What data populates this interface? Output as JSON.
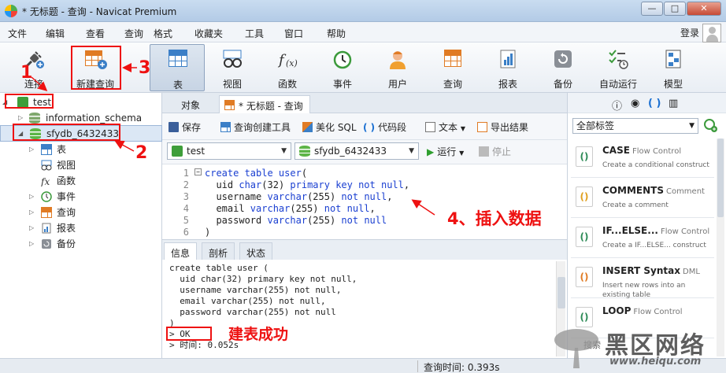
{
  "window": {
    "title": "* 无标题 - 查询 - Navicat Premium",
    "min": "—",
    "max": "□",
    "close": "✕"
  },
  "menu": [
    "文件",
    "编辑",
    "查看",
    "查询",
    "格式",
    "收藏夹",
    "工具",
    "窗口",
    "帮助"
  ],
  "login": "登录",
  "toolbar": [
    {
      "label": "连接",
      "icon": "plug-icon"
    },
    {
      "label": "新建查询",
      "icon": "new-query-icon"
    },
    {
      "label": "表",
      "icon": "table-icon"
    },
    {
      "label": "视图",
      "icon": "view-icon"
    },
    {
      "label": "函数",
      "icon": "function-icon"
    },
    {
      "label": "事件",
      "icon": "clock-icon"
    },
    {
      "label": "用户",
      "icon": "user-icon"
    },
    {
      "label": "查询",
      "icon": "query-icon"
    },
    {
      "label": "报表",
      "icon": "report-icon"
    },
    {
      "label": "备份",
      "icon": "backup-icon"
    },
    {
      "label": "自动运行",
      "icon": "schedule-icon"
    },
    {
      "label": "模型",
      "icon": "model-icon"
    }
  ],
  "tree": {
    "connection": "test",
    "databases": [
      "information_schema",
      "sfydb_6432433"
    ],
    "children": [
      "表",
      "视图",
      "函数",
      "事件",
      "查询",
      "报表",
      "备份"
    ]
  },
  "tabs": {
    "objects": "对象",
    "query": "* 无标题 - 查询"
  },
  "query_toolbar": {
    "save": "保存",
    "builder": "查询创建工具",
    "beautify": "美化 SQL",
    "snippet": "代码段",
    "text": "文本",
    "export": "导出结果"
  },
  "selectors": {
    "connection": "test",
    "database": "sfydb_6432433",
    "run": "运行",
    "stop": "停止"
  },
  "editor": {
    "lines": [
      {
        "n": "1",
        "parts": [
          [
            "kw",
            "create table user"
          ],
          [
            "",
            "("
          ]
        ]
      },
      {
        "n": "2",
        "parts": [
          [
            "",
            "  uid "
          ],
          [
            "kw",
            "char"
          ],
          [
            "",
            "(32) "
          ],
          [
            "kw",
            "primary key not null"
          ],
          [
            "",
            ","
          ]
        ]
      },
      {
        "n": "3",
        "parts": [
          [
            "",
            "  username "
          ],
          [
            "kw",
            "varchar"
          ],
          [
            "",
            "(255) "
          ],
          [
            "kw",
            "not null"
          ],
          [
            "",
            ","
          ]
        ]
      },
      {
        "n": "4",
        "parts": [
          [
            "",
            "  email "
          ],
          [
            "kw",
            "varchar"
          ],
          [
            "",
            "(255) "
          ],
          [
            "kw",
            "not null"
          ],
          [
            "",
            ","
          ]
        ]
      },
      {
        "n": "5",
        "parts": [
          [
            "",
            "  password "
          ],
          [
            "kw",
            "varchar"
          ],
          [
            "",
            "(255) "
          ],
          [
            "kw",
            "not null"
          ]
        ]
      },
      {
        "n": "6",
        "parts": [
          [
            "",
            ")"
          ]
        ]
      }
    ]
  },
  "info_tabs": [
    "信息",
    "剖析",
    "状态"
  ],
  "info": {
    "lines": [
      "create table user (",
      "  uid char(32) primary key not null,",
      "  username varchar(255) not null,",
      "  email varchar(255) not null,",
      "  password varchar(255) not null",
      ")",
      "> OK",
      "> 时间: 0.052s"
    ]
  },
  "right": {
    "tag_select": "全部标签",
    "snippets": [
      {
        "title": "CASE",
        "tag": "Flow Control",
        "desc": "Create a conditional construct"
      },
      {
        "title": "COMMENTS",
        "tag": "Comment",
        "desc": "Create a comment"
      },
      {
        "title": "IF...ELSE...",
        "tag": "Flow Control",
        "desc": "Create a IF...ELSE... construct"
      },
      {
        "title": "INSERT Syntax",
        "tag": "DML",
        "desc": "Insert new rows into an existing table"
      },
      {
        "title": "LOOP",
        "tag": "Flow Control",
        "desc": ""
      }
    ],
    "search": "搜索"
  },
  "status": {
    "query_time": "查询时间: 0.393s"
  },
  "annotations": {
    "n1": "1",
    "n2": "2",
    "n3": "3",
    "insert": "4、插入数据",
    "success": "建表成功"
  },
  "watermark": {
    "brand": "黑区网络",
    "url": "www.heiqu.com"
  },
  "colors": {
    "annotation_red": "#e11111",
    "keyword_blue": "#1a3fd1",
    "selected_row": "#dbe7f5"
  }
}
